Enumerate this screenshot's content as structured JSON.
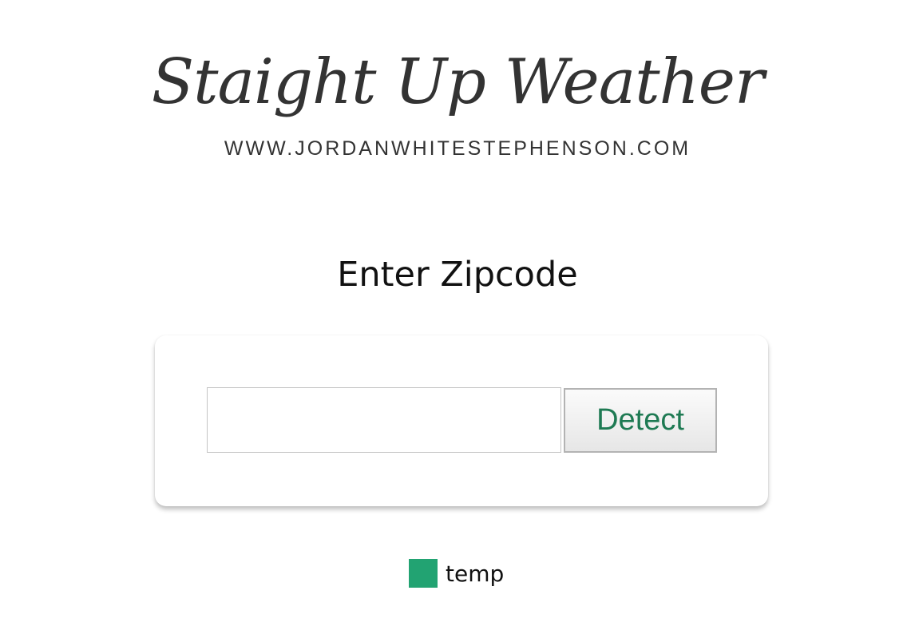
{
  "header": {
    "title": "Staight Up Weather",
    "url": "WWW.JORDANWHITESTEPHENSON.COM"
  },
  "main": {
    "heading": "Enter Zipcode",
    "zip_input": {
      "value": "",
      "placeholder": ""
    },
    "detect_button_label": "Detect"
  },
  "legend": {
    "label": "temp",
    "color": "#22a372"
  },
  "colors": {
    "button_text": "#1e7a53",
    "text": "#333333"
  }
}
